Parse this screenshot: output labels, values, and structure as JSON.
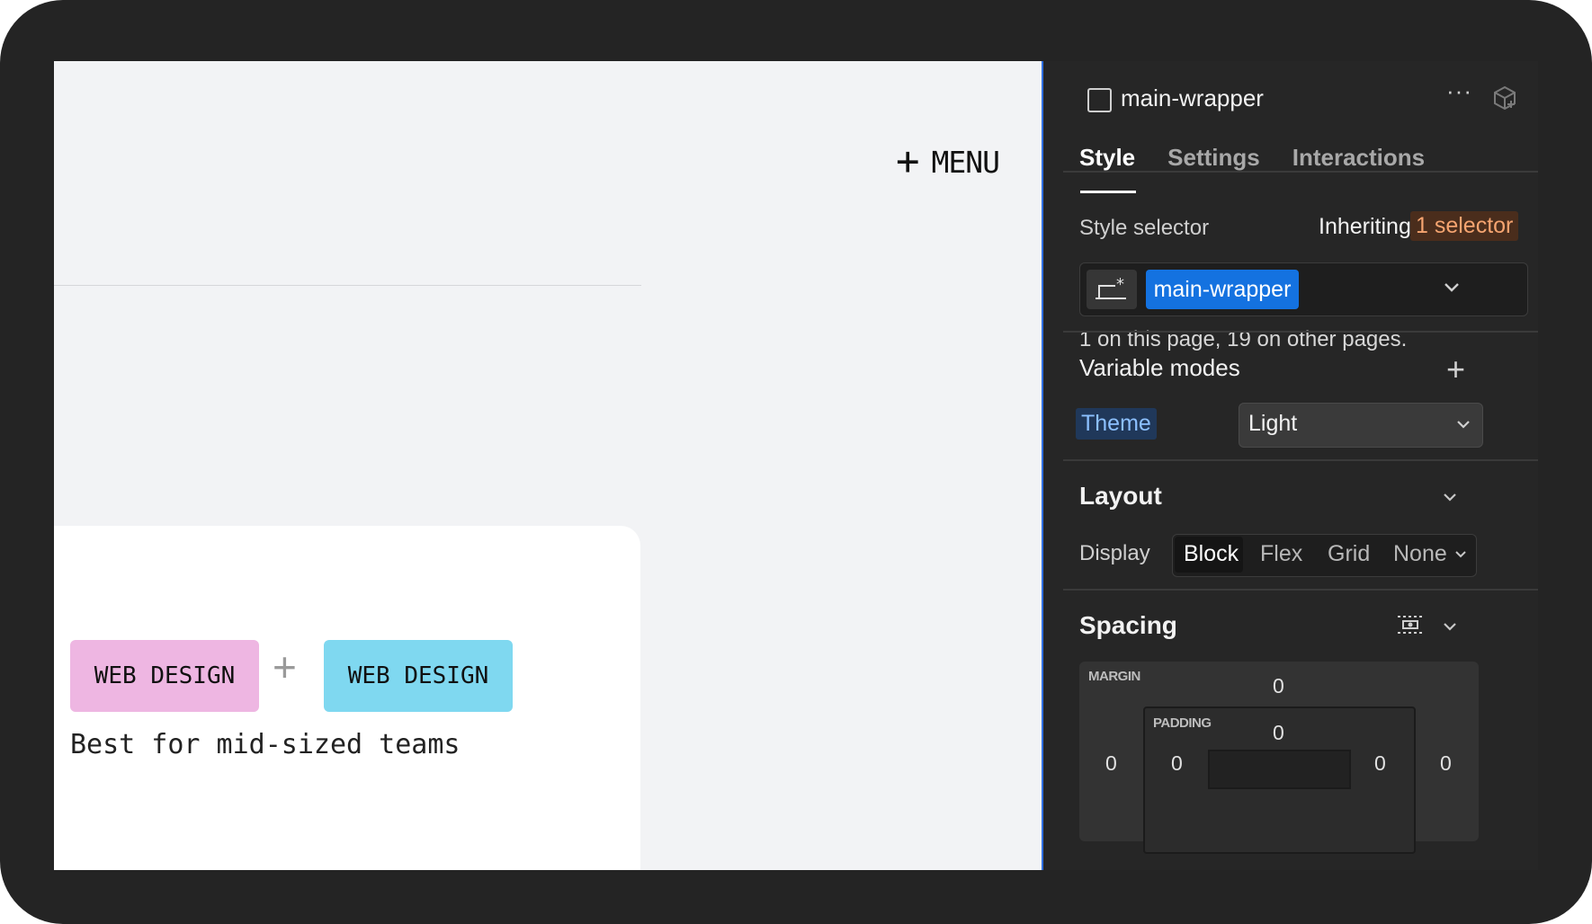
{
  "canvas": {
    "menu_label": "MENU",
    "tags": [
      "WEB DESIGN",
      "WEB DESIGN"
    ],
    "caption": "Best for mid-sized teams"
  },
  "panel": {
    "element_name": "main-wrapper",
    "tabs": [
      {
        "label": "Style",
        "active": true
      },
      {
        "label": "Settings",
        "active": false
      },
      {
        "label": "Interactions",
        "active": false
      }
    ],
    "style_selector": {
      "label": "Style selector",
      "inheriting_text": "Inheriting",
      "inherit_badge": "1 selector",
      "selected_class": "main-wrapper",
      "usage_text": "1 on this page, 19 on other pages."
    },
    "variable_modes": {
      "title": "Variable modes",
      "mode_label": "Theme",
      "mode_value": "Light"
    },
    "layout": {
      "title": "Layout",
      "display_label": "Display",
      "options": [
        "Block",
        "Flex",
        "Grid",
        "None"
      ],
      "selected": "Block"
    },
    "spacing": {
      "title": "Spacing",
      "margin_label": "MARGIN",
      "padding_label": "PADDING",
      "margin_top": "0",
      "margin_left": "0",
      "margin_right": "0",
      "padding_top": "0",
      "padding_left": "0",
      "padding_right": "0"
    }
  },
  "colors": {
    "tag_pink": "#eeb6e2",
    "tag_cyan": "#7fd8f0",
    "accent_blue": "#1472e0",
    "inherit_orange": "#f5a470"
  }
}
